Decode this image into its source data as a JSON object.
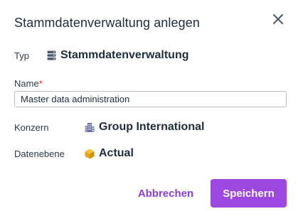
{
  "dialog": {
    "title": "Stammdatenverwaltung anlegen",
    "close_icon": "close-icon"
  },
  "fields": {
    "typ": {
      "label": "Typ",
      "value": "Stammdatenverwaltung",
      "icon": "database-icon"
    },
    "name": {
      "label": "Name",
      "required_marker": "*",
      "value": "Master data administration"
    },
    "konzern": {
      "label": "Konzern",
      "value": "Group International",
      "icon": "building-icon"
    },
    "datenebene": {
      "label": "Datenebene",
      "value": "Actual",
      "icon": "cube-icon"
    }
  },
  "actions": {
    "cancel_label": "Abbrechen",
    "save_label": "Speichern"
  },
  "colors": {
    "accent": "#9b47e0",
    "accent_text": "#8b3fd9",
    "required": "#d0342c",
    "text": "#1f2d3d"
  }
}
